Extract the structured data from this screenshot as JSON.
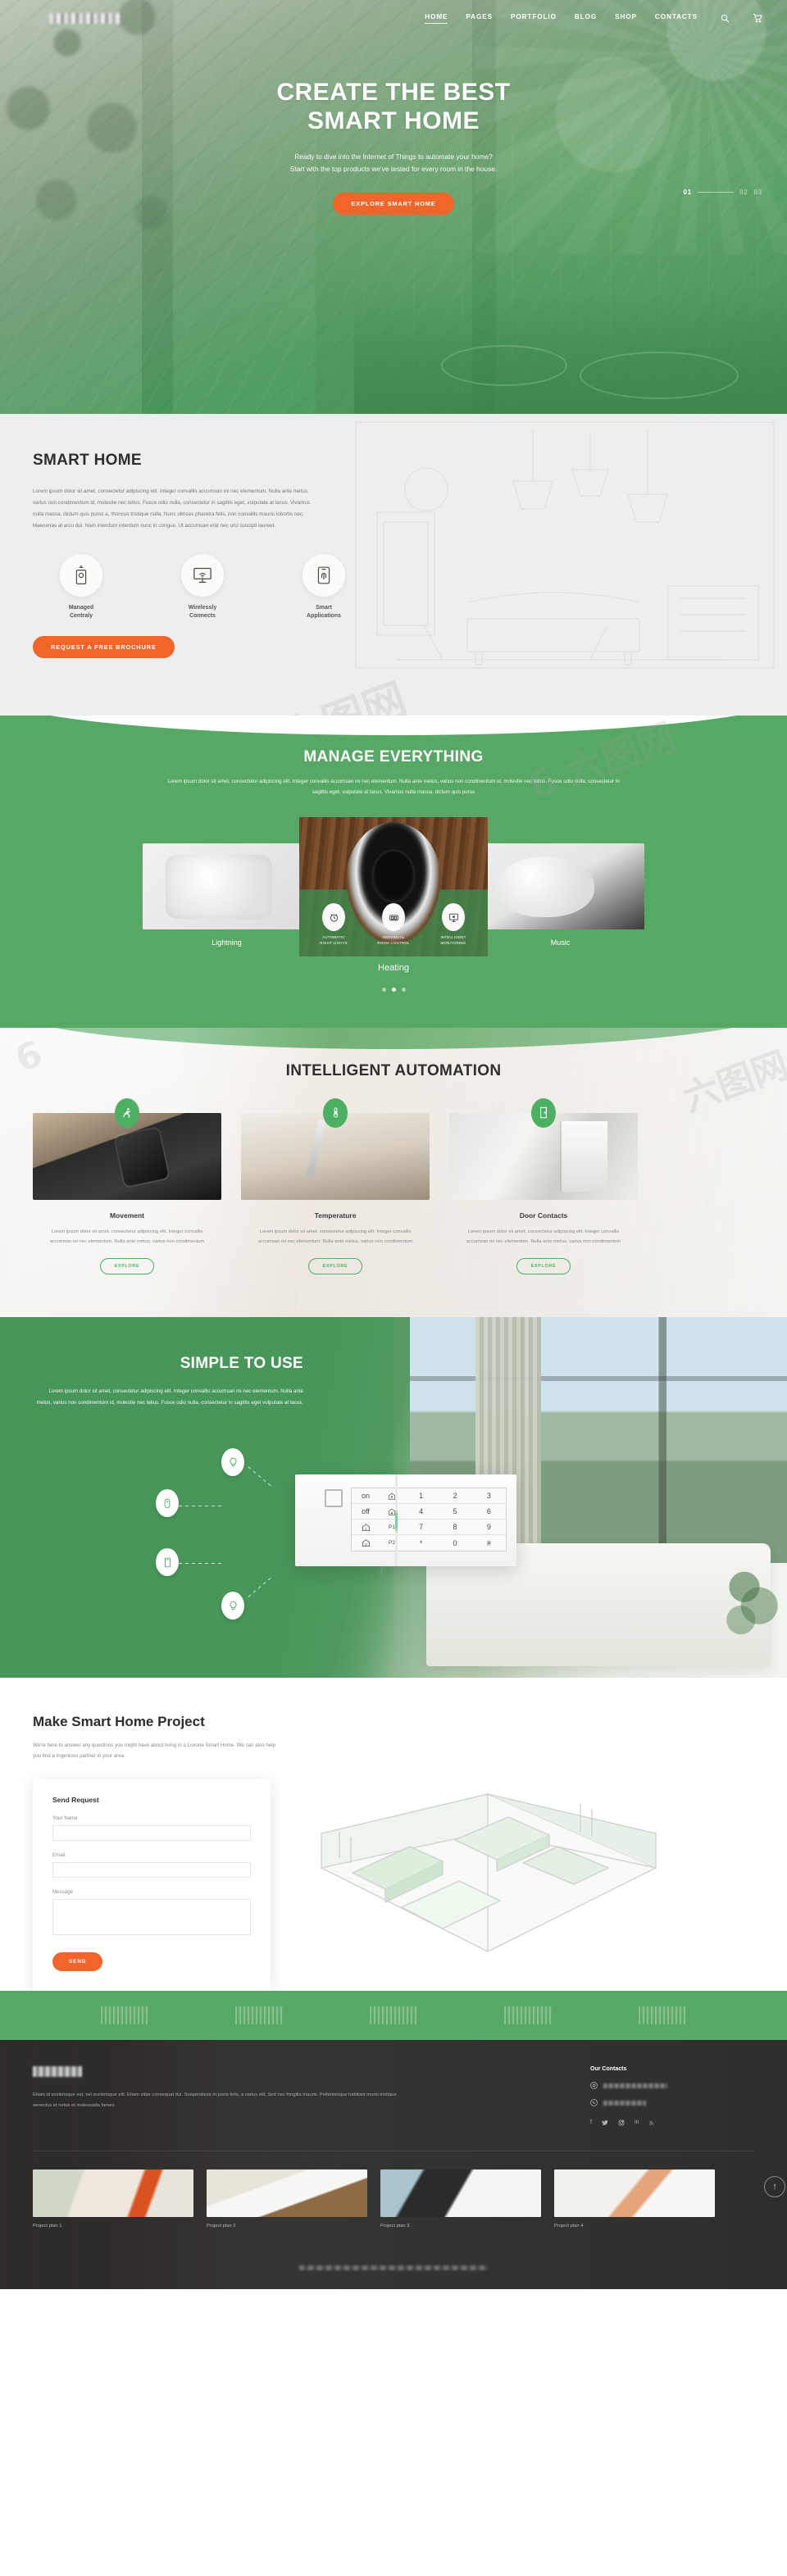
{
  "brand": {
    "logo_alt": "site-logo (obscured)",
    "accent_orange": "#f2652a",
    "accent_green": "#57a864"
  },
  "nav": {
    "items": [
      {
        "label": "HOME",
        "active": true
      },
      {
        "label": "PAGES",
        "active": false
      },
      {
        "label": "PORTFOLIO",
        "active": false
      },
      {
        "label": "BLOG",
        "active": false
      },
      {
        "label": "SHOP",
        "active": false
      },
      {
        "label": "CONTACTS",
        "active": false
      }
    ],
    "search_icon": "search-icon",
    "cart_icon": "cart-icon"
  },
  "hero": {
    "title_line1": "CREATE THE BEST",
    "title_line2": "SMART HOME",
    "sub_line1": "Ready to dive into the Internet of Things to automate your home?",
    "sub_line2": "Start with the top products we've tested for every room in the house.",
    "cta": "EXPLORE SMART HOME",
    "slides": [
      "01",
      "02",
      "03"
    ],
    "active_slide": "01"
  },
  "smart_home": {
    "title": "SMART HOME",
    "body": "Lorem ipsum dolor sit amet, consectetur adipiscing elit. Integer convallis accumsan mi nec elementum. Nulla ante metus, varius non condimentum id, molestie nec tellus. Fusce odio nulla, consectetur in sagittis eget, vulputate at lacus. Vivamus nulla massa, dictum quis purus a, rhoncus tristique nulla. Nunc ultrices pharetra felis, non convallis mauris lobortis nec. Maecenas at arcu dui. Nam interdum interdum nunc in congue. Ut accumsan erat nec orci suscipit laoreet.",
    "features": [
      {
        "label_line1": "Managed",
        "label_line2": "Centraly",
        "icon": "remote-control-icon"
      },
      {
        "label_line1": "Wirelessly",
        "label_line2": "Connects",
        "icon": "monitor-wifi-icon"
      },
      {
        "label_line1": "Smart",
        "label_line2": "Applications",
        "icon": "smartphone-app-icon"
      }
    ],
    "cta": "REQUEST A FREE BROCHURE"
  },
  "manage": {
    "title": "MANAGE EVERYTHING",
    "sub_line1": "Lorem ipsum dolor sit amet, consectetur adipiscing elit. Integer convallis accumsan mi nec elementum. Nulla ante metus, varius non condimentum id,",
    "sub_line2": "molestie nec tellus. Fusce odio nulla, consectetur in sagittis eget, vulputate at lacus. Vivamus nulla massa, dictum quis purus",
    "cards": [
      {
        "label": "Lightning"
      },
      {
        "label": "Heating"
      },
      {
        "label": "Music"
      }
    ],
    "center_icons": [
      {
        "line1": "AUTOMATIC",
        "line2": "NIGHT LIGHTS",
        "icon": "alarm-clock-icon"
      },
      {
        "line1": "INDIVIDUAL",
        "line2": "ROOM CONTROL",
        "icon": "switch-panel-icon"
      },
      {
        "line1": "INTELLIGENT",
        "line2": "MONITORING",
        "icon": "monitor-speaker-icon"
      }
    ],
    "dots": 3,
    "active_dot": 1
  },
  "automation": {
    "title": "INTELLIGENT AUTOMATION",
    "cards": [
      {
        "title": "Movement",
        "icon": "running-person-icon",
        "text": "Lorem ipsum dolor sit amet, consectetur adipiscing elit. Integer convallis accumsan mi nec elementum. Nulla ante metus, varius non condimentum",
        "cta": "EXPLORE"
      },
      {
        "title": "Temperature",
        "icon": "thermometer-icon",
        "text": "Lorem ipsum dolor sit amet, consectetur adipiscing elit. Integer convallis accumsan mi nec elementum. Nulla ante metus, varius non condimentum",
        "cta": "EXPLORE"
      },
      {
        "title": "Door Contacts",
        "icon": "door-icon",
        "text": "Lorem ipsum dolor sit amet, consectetur adipiscing elit. Integer convallis accumsan mi nec elementum. Nulla ante metus, varius non condimentum",
        "cta": "EXPLORE"
      }
    ]
  },
  "simple": {
    "title": "SIMPLE TO USE",
    "body": "Lorem ipsum dolor sit amet, consectetur adipiscing elit. Integer convallis accumsan mi nec elementum. Nulla ante metus, varius non condimentum id, molestie nec tellus. Fusce odio nulla, consectetur in sagittis eget vulputate at lacus.",
    "nodes": [
      {
        "icon": "lightbulb-node-icon"
      },
      {
        "icon": "mouse-node-icon"
      },
      {
        "icon": "smartphone-node-icon"
      },
      {
        "icon": "lightbulb-node-icon-2"
      }
    ],
    "keypad": {
      "rows": [
        [
          "on",
          "house-up",
          "1",
          "2",
          "3"
        ],
        [
          "off",
          "house-down",
          "4",
          "5",
          "6"
        ],
        [
          "house-1",
          "P1",
          "7",
          "8",
          "9"
        ],
        [
          "house-2",
          "P2",
          "*",
          "0",
          "#"
        ]
      ]
    }
  },
  "project": {
    "title": "Make Smart Home Project",
    "sub": "We're here to answer any questions you might have about living in a Loxone Smart Home. We can also help you find a Ingenious partner in your area.",
    "form": {
      "title": "Send Request",
      "fields": [
        {
          "label": "Your Name",
          "value": "",
          "placeholder": "",
          "type": "text"
        },
        {
          "label": "Email",
          "value": "",
          "placeholder": "",
          "type": "text"
        },
        {
          "label": "Message",
          "value": "",
          "placeholder": "",
          "type": "textarea"
        }
      ],
      "submit": "SEND"
    }
  },
  "partners": {
    "count": 5
  },
  "footer": {
    "logo_alt": "footer-logo (obscured)",
    "about": "Etiam id scelerisque est, vel scelerisque elit. Etiam vitae consequat dui. Suspendisse in porta felis, a varius elit. Sed nec fringilla mauris. Pellentesque habitant morbi tristique senectus et netus et malesuada fames.",
    "contacts_title": "Our Contacts",
    "contacts": [
      {
        "icon": "location-icon",
        "value_obscured": true
      },
      {
        "icon": "phone-icon",
        "value_obscured": true
      }
    ],
    "socials": [
      {
        "icon": "facebook-icon",
        "glyph": "f"
      },
      {
        "icon": "twitter-icon",
        "glyph": "🐦"
      },
      {
        "icon": "instagram-icon",
        "glyph": "◙"
      },
      {
        "icon": "linkedin-icon",
        "glyph": "in"
      },
      {
        "icon": "rss-icon",
        "glyph": "≋"
      }
    ],
    "gallery": [
      {
        "label": "Project plan 1"
      },
      {
        "label": "Project plan 2"
      },
      {
        "label": "Project plan 3"
      },
      {
        "label": "Project plan 4"
      }
    ],
    "to_top_icon": "arrow-up-icon",
    "copyright_obscured": true
  },
  "watermarks": [
    "6 六图网",
    "六图网",
    "6",
    "六图网"
  ]
}
